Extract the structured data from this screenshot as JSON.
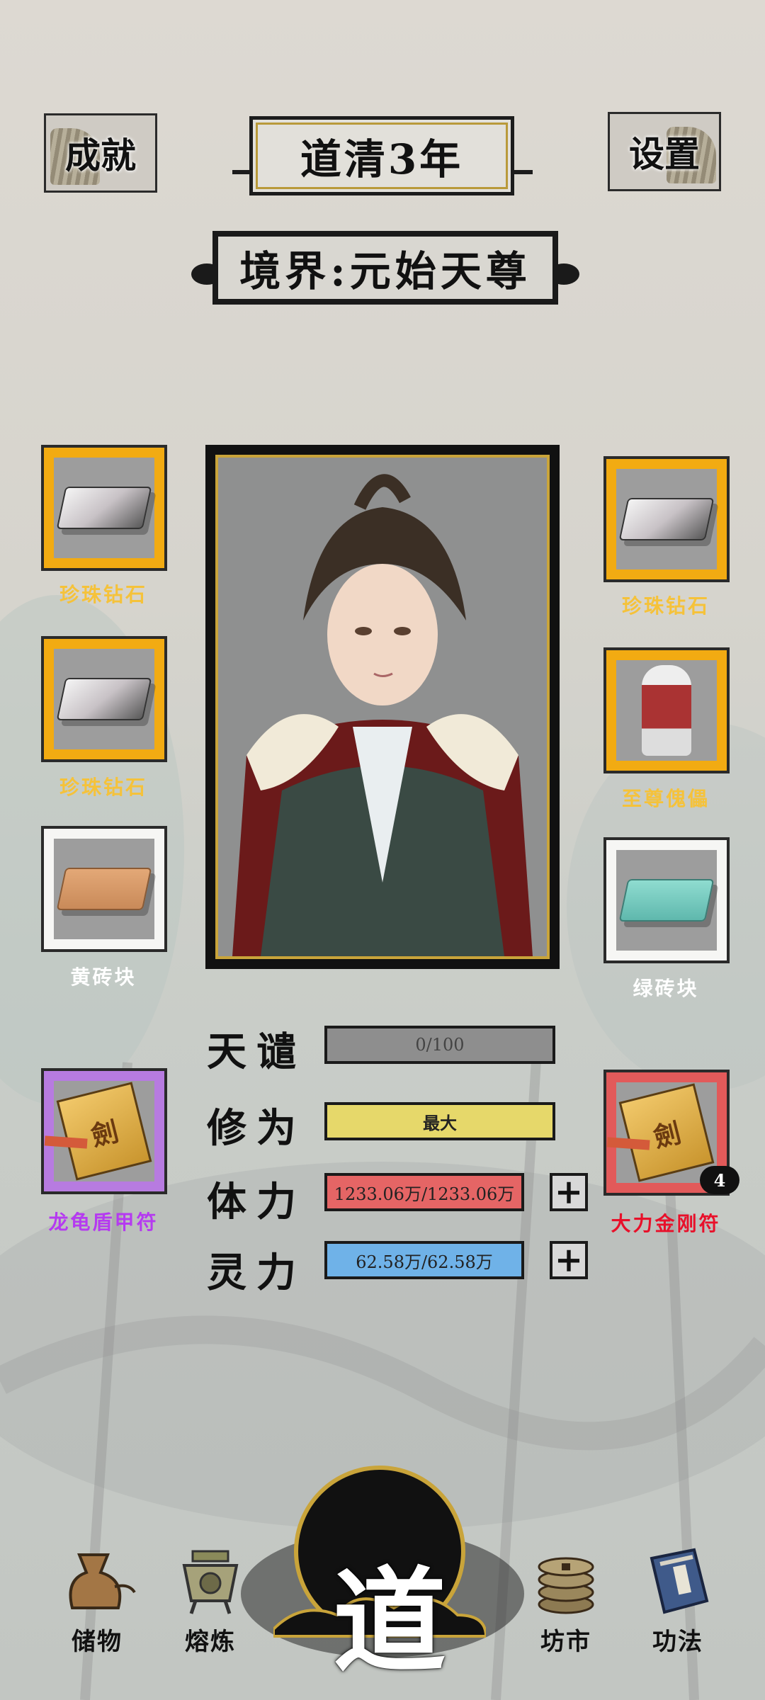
{
  "header": {
    "achievements_label": "成就",
    "year_title": "道清3年",
    "settings_label": "设置"
  },
  "realm": {
    "text": "境界:元始天尊"
  },
  "left_items": [
    {
      "label": "珍珠钻石",
      "rarity": "gold"
    },
    {
      "label": "珍珠钻石",
      "rarity": "gold"
    },
    {
      "label": "黄砖块",
      "rarity": "white"
    },
    {
      "label": "龙龟盾甲符",
      "rarity": "purple"
    }
  ],
  "right_items": [
    {
      "label": "珍珠钻石",
      "rarity": "gold"
    },
    {
      "label": "至尊傀儡",
      "rarity": "gold"
    },
    {
      "label": "绿砖块",
      "rarity": "white"
    },
    {
      "label": "大力金刚符",
      "rarity": "red",
      "count": "4"
    }
  ],
  "stats": {
    "tianqian": {
      "label": "天谴",
      "value": "0/100"
    },
    "xiuwei": {
      "label": "修为",
      "value": "最大"
    },
    "tili": {
      "label": "体力",
      "value": "1233.06万/1233.06万"
    },
    "lingli": {
      "label": "灵力",
      "value": "62.58万/62.58万"
    }
  },
  "nav": {
    "storage": "储物",
    "smelt": "熔炼",
    "dao": "道",
    "market": "坊市",
    "skills": "功法"
  },
  "colors": {
    "gold_slot": "#f2ab12",
    "purple_slot": "#b77be0",
    "red_slot": "#e25a5a",
    "hp_bar": "#e56565",
    "mp_bar": "#6fb2e8"
  }
}
